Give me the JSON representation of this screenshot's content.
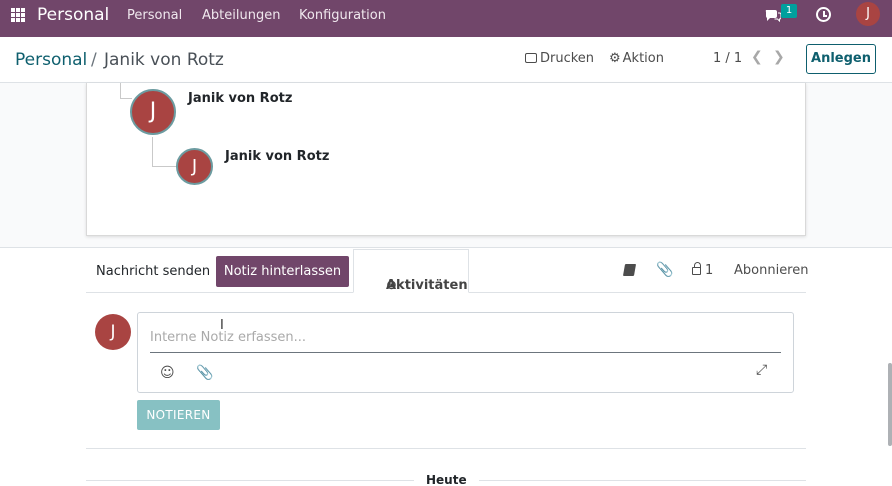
{
  "navbar": {
    "brand": "Personal",
    "menu": [
      "Personal",
      "Abteilungen",
      "Konfiguration"
    ],
    "messages_count": "1",
    "user_initial": "J",
    "color": "#71466a"
  },
  "control_panel": {
    "breadcrumb_parent": "Personal",
    "breadcrumb_separator": "/",
    "breadcrumb_current": "Janik von Rotz",
    "print_label": "Drucken",
    "action_label": "Aktion",
    "pager": "1 / 1",
    "create_label": "Anlegen"
  },
  "org_chart": {
    "manager": {
      "name": "Janik von Rotz",
      "initial": "J"
    },
    "employee": {
      "name": "Janik von Rotz",
      "initial": "J"
    }
  },
  "chatter": {
    "send_message": "Nachricht senden",
    "log_note": "Notiz hinterlassen",
    "activities": "Aktivitäten",
    "followers_count": "1",
    "subscribe": "Abonnieren",
    "composer_placeholder": "Interne Notiz erfassen...",
    "composer_initial": "J",
    "submit_label": "NOTIEREN",
    "today_label": "Heute"
  },
  "icons": [
    "apps-icon",
    "chat-icon",
    "clock-icon",
    "print-icon",
    "gear-icon",
    "chevron-left-icon",
    "chevron-right-icon",
    "book-icon",
    "paperclip-icon",
    "lock-icon",
    "emoji-icon",
    "expand-icon"
  ],
  "colors": {
    "brand": "#71466a",
    "link": "#0e5f6e",
    "avatar": "#a94442",
    "submit": "#87c1c3",
    "badge": "#00a09d"
  }
}
